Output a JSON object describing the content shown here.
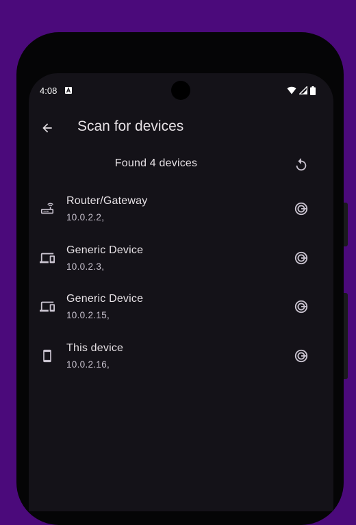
{
  "status_bar": {
    "time": "4:08",
    "icons": [
      "notification-a-icon",
      "wifi-icon",
      "cellular-icon",
      "battery-icon"
    ]
  },
  "app_bar": {
    "title": "Scan for devices",
    "back_icon": "arrow-back-icon"
  },
  "scan": {
    "found_label": "Found 4 devices",
    "refresh_icon": "refresh-icon"
  },
  "devices": [
    {
      "name": "Router/Gateway",
      "ip": "10.0.2.2,",
      "icon": "router-icon"
    },
    {
      "name": "Generic Device",
      "ip": "10.0.2.3,",
      "icon": "devices-icon"
    },
    {
      "name": "Generic Device",
      "ip": "10.0.2.15,",
      "icon": "devices-icon"
    },
    {
      "name": "This device",
      "ip": "10.0.2.16,",
      "icon": "smartphone-icon"
    }
  ],
  "colors": {
    "background": "#4b0a7b",
    "surface": "#141218",
    "on_surface": "#e6e1e5",
    "on_surface_variant": "#cac4d0"
  }
}
